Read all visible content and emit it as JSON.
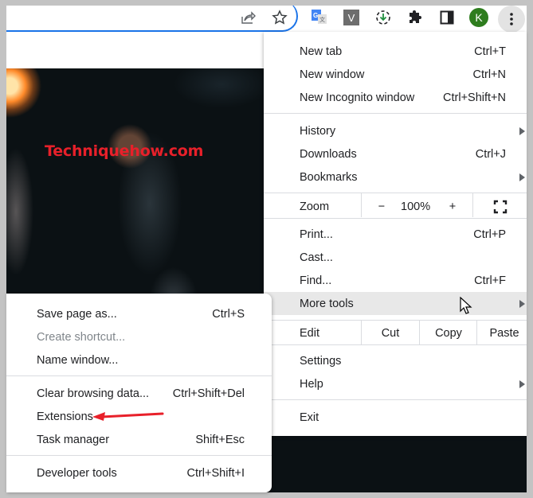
{
  "watermark": "Techniquehow.com",
  "toolbar": {
    "icons": [
      "share-icon",
      "bookmark-star-icon",
      "google-translate-icon",
      "v-extension-icon",
      "download-progress-icon",
      "extensions-puzzle-icon",
      "side-panel-icon",
      "profile-avatar",
      "more-menu-icon"
    ],
    "avatar_letter": "K",
    "v_ext_letter": "V",
    "translate_letter": "G"
  },
  "main_menu": {
    "groups": [
      [
        {
          "label": "New tab",
          "shortcut": "Ctrl+T"
        },
        {
          "label": "New window",
          "shortcut": "Ctrl+N"
        },
        {
          "label": "New Incognito window",
          "shortcut": "Ctrl+Shift+N"
        }
      ],
      [
        {
          "label": "History",
          "submenu": true
        },
        {
          "label": "Downloads",
          "shortcut": "Ctrl+J"
        },
        {
          "label": "Bookmarks",
          "submenu": true
        }
      ]
    ],
    "zoom": {
      "label": "Zoom",
      "minus": "−",
      "value": "100%",
      "plus": "+"
    },
    "tools": [
      {
        "label": "Print...",
        "shortcut": "Ctrl+P"
      },
      {
        "label": "Cast..."
      },
      {
        "label": "Find...",
        "shortcut": "Ctrl+F"
      },
      {
        "label": "More tools",
        "submenu": true,
        "highlighted": true
      }
    ],
    "edit": {
      "label": "Edit",
      "cut": "Cut",
      "copy": "Copy",
      "paste": "Paste"
    },
    "settings_group": [
      {
        "label": "Settings"
      },
      {
        "label": "Help",
        "submenu": true
      }
    ],
    "exit": {
      "label": "Exit"
    }
  },
  "more_tools_submenu": {
    "items": [
      {
        "label": "Save page as...",
        "shortcut": "Ctrl+S"
      },
      {
        "label": "Create shortcut...",
        "disabled": true
      },
      {
        "label": "Name window..."
      },
      {
        "label": "Clear browsing data...",
        "shortcut": "Ctrl+Shift+Del"
      },
      {
        "label": "Extensions",
        "annotated": true
      },
      {
        "label": "Task manager",
        "shortcut": "Shift+Esc"
      },
      {
        "label": "Developer tools",
        "shortcut": "Ctrl+Shift+I"
      }
    ]
  },
  "colors": {
    "accent": "#1a73e8",
    "annotation_red": "#e8202a",
    "avatar_green": "#2e7d1e",
    "menu_hover": "#e8e8e8"
  }
}
